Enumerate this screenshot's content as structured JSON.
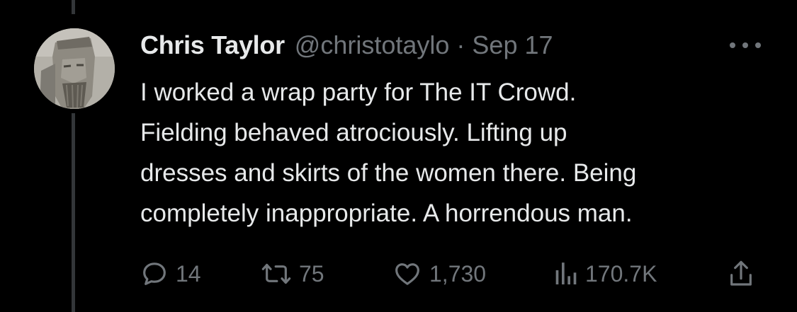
{
  "tweet": {
    "display_name": "Chris Taylor",
    "handle": "@christotaylo",
    "separator": "·",
    "date": "Sep 17",
    "text_lines": [
      "I worked a wrap party for The IT Crowd.",
      "Fielding behaved atrociously. Lifting up",
      "dresses and skirts of the women there. Being",
      "completely inappropriate. A horrendous man."
    ]
  },
  "actions": {
    "replies": "14",
    "reposts": "75",
    "likes": "1,730",
    "views": "170.7K"
  },
  "icons": {
    "more": "more-horizontal-icon",
    "reply": "reply-bubble-icon",
    "repost": "repost-arrows-icon",
    "like": "heart-icon",
    "views": "views-bar-chart-icon",
    "share": "share-upload-icon"
  },
  "colors": {
    "background": "#000000",
    "primary_text": "#e7e9ea",
    "secondary_text": "#71767b",
    "thread_line": "#333639"
  }
}
